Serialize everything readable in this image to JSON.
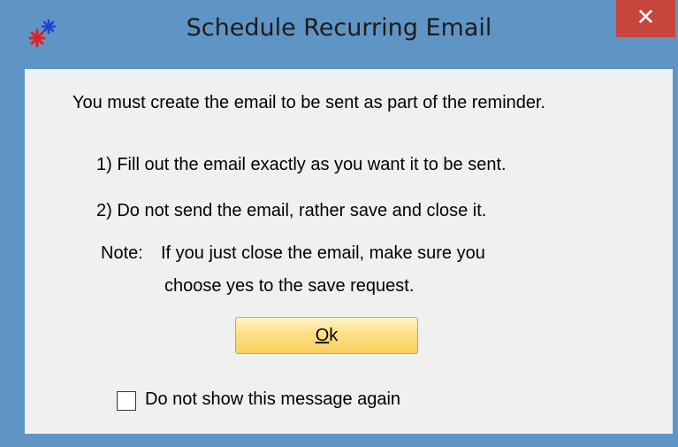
{
  "window": {
    "title": "Schedule Recurring Email",
    "close_glyph": "✕",
    "app_icon": "recurring-star-icon",
    "colors": {
      "frame": "#5f95c5",
      "close": "#c7453a",
      "client_bg": "#f0f0f0",
      "ok_button": "#fddf86"
    }
  },
  "message": {
    "intro": "You must create the email to be sent as part of the reminder.",
    "step1": "1) Fill out the email exactly as you want it to be sent.",
    "step2": "2) Do not send the email, rather save and close it.",
    "note_label": "Note:",
    "note_line1": "If you just close the email, make sure you",
    "note_line2": "choose yes to the save request."
  },
  "buttons": {
    "ok_mnemonic": "O",
    "ok_rest": "k"
  },
  "checkbox": {
    "label": "Do not show this message again",
    "checked": false
  }
}
